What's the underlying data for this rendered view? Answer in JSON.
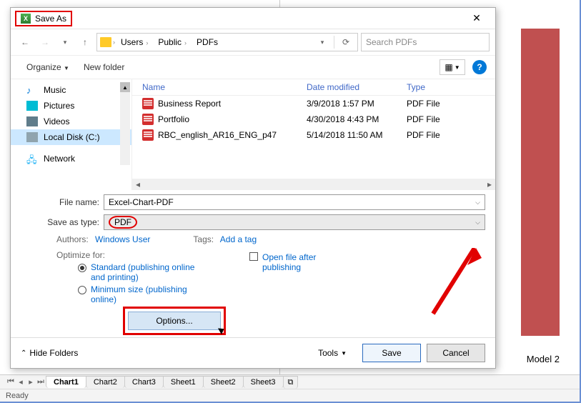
{
  "bg": {
    "model_label": "Model 2"
  },
  "titlebar": {
    "title": "Save As"
  },
  "nav": {
    "crumbs": [
      "Users",
      "Public",
      "PDFs"
    ],
    "search_placeholder": "Search PDFs",
    "refresh_tooltip": "Refresh"
  },
  "toolbar": {
    "organize": "Organize",
    "newfolder": "New folder"
  },
  "navpane": {
    "items": [
      {
        "label": "Music",
        "icon": "music"
      },
      {
        "label": "Pictures",
        "icon": "pic"
      },
      {
        "label": "Videos",
        "icon": "vid"
      },
      {
        "label": "Local Disk (C:)",
        "icon": "disk",
        "selected": true
      },
      {
        "label": "Network",
        "icon": "net"
      }
    ]
  },
  "files": {
    "columns": {
      "name": "Name",
      "date": "Date modified",
      "type": "Type"
    },
    "rows": [
      {
        "name": "Business Report",
        "date": "3/9/2018 1:57 PM",
        "type": "PDF File"
      },
      {
        "name": "Portfolio",
        "date": "4/30/2018 4:43 PM",
        "type": "PDF File"
      },
      {
        "name": "RBC_english_AR16_ENG_p47",
        "date": "5/14/2018 11:50 AM",
        "type": "PDF File"
      }
    ]
  },
  "form": {
    "filename_label": "File name:",
    "filename_value": "Excel-Chart-PDF",
    "type_label": "Save as type:",
    "type_value": "PDF",
    "authors_label": "Authors:",
    "authors_value": "Windows User",
    "tags_label": "Tags:",
    "tags_value": "Add a tag",
    "optimize_label": "Optimize for:",
    "opt_standard": "Standard (publishing online and printing)",
    "opt_minimum": "Minimum size (publishing online)",
    "open_after": "Open file after publishing",
    "options": "Options..."
  },
  "bottom": {
    "hide": "Hide Folders",
    "tools": "Tools",
    "save": "Save",
    "cancel": "Cancel"
  },
  "sheets": {
    "tabs": [
      "Chart1",
      "Chart2",
      "Chart3",
      "Sheet1",
      "Sheet2",
      "Sheet3"
    ],
    "status": "Ready"
  }
}
